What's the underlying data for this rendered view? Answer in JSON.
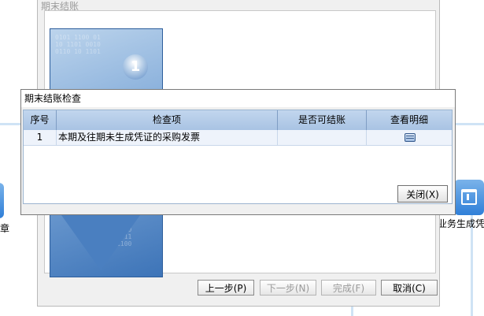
{
  "background_app": {
    "left_label": "章",
    "right_label": "业务生成凭",
    "tile_icon": "report-icon"
  },
  "wizard": {
    "title": "期末结账",
    "step_number": "1",
    "buttons": {
      "prev": "上一步(P)",
      "next": "下一步(N)",
      "finish": "完成(F)",
      "cancel": "取消(C)"
    }
  },
  "dialog": {
    "title": "期末结账检查",
    "columns": [
      "序号",
      "检查项",
      "是否可结账",
      "查看明细"
    ],
    "rows": [
      {
        "index": "1",
        "item": "本期及往期未生成凭证的采购发票",
        "can_close": "",
        "detail_icon": "table-detail-icon"
      }
    ],
    "close_button": "关闭(X)"
  }
}
